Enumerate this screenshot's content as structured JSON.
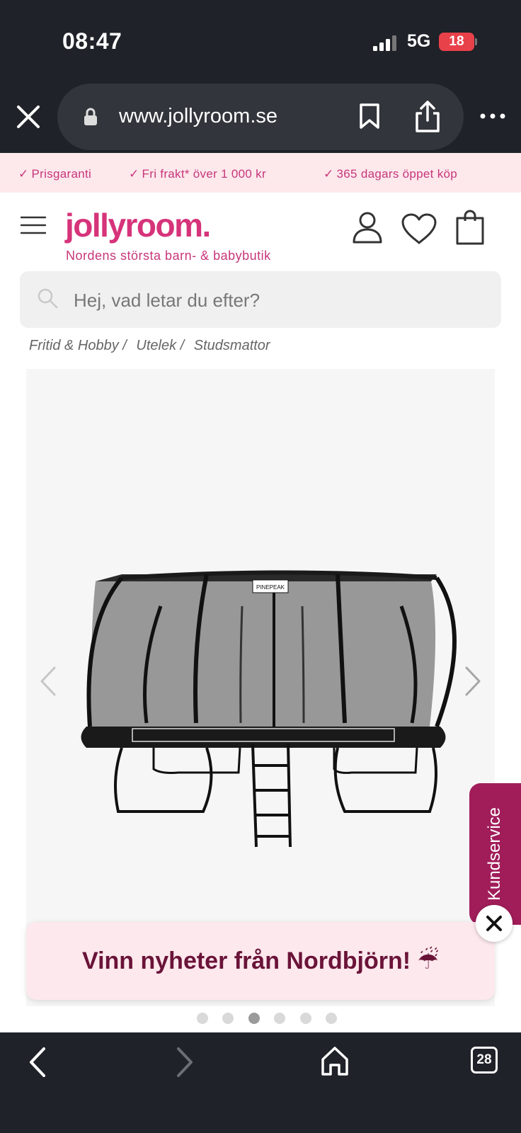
{
  "status_bar": {
    "time": "08:47",
    "network": "5G",
    "battery": "18"
  },
  "browser": {
    "url": "www.jollyroom.se",
    "tab_count": "28"
  },
  "usp_bar": {
    "items": [
      "Prisgaranti",
      "Fri frakt* över 1 000 kr",
      "365 dagars öppet köp"
    ],
    "check": "✓"
  },
  "header": {
    "logo": "jollyroom.",
    "tagline": "Nordens största barn- & babybutik"
  },
  "search": {
    "placeholder": "Hej, vad letar du efter?"
  },
  "breadcrumb": {
    "items": [
      "Fritid & Hobby /",
      "Utelek /",
      "Studsmattor"
    ]
  },
  "gallery": {
    "brand_tag": "PINEPEAK",
    "slide_count": 6,
    "active_slide": 3
  },
  "kundservice": {
    "label": "Kundservice"
  },
  "promo": {
    "text": "Vinn nyheter från Nordbjörn! ☔"
  },
  "colors": {
    "brand_pink": "#d6337a",
    "usp_bg": "#fde8ec",
    "kundservice_bg": "#a11d5a",
    "promo_text": "#6a1338",
    "chrome_bg": "#1f2228"
  }
}
